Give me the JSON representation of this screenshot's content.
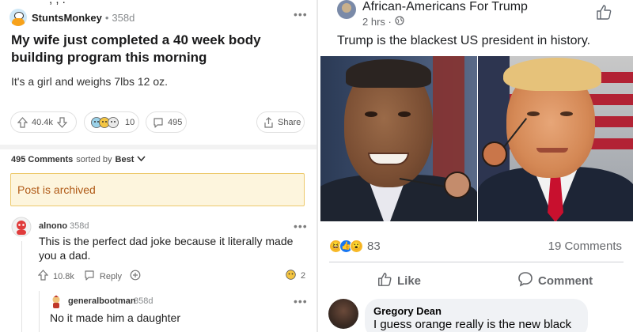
{
  "reddit": {
    "post": {
      "username": "StuntsMonkey",
      "age": "358d",
      "title": "My wife just completed a 40 week body building program this morning",
      "body": "It's a girl and weighs 7lbs 12 oz.",
      "score": "40.4k",
      "awards_count": "10",
      "comments_count": "495",
      "share_label": "Share"
    },
    "sort": {
      "count_label": "495 Comments",
      "sorted_by_label": "sorted by",
      "value": "Best"
    },
    "archived_notice": "Post is archived",
    "comments": [
      {
        "username": "alnono",
        "age": "358d",
        "text": "This is the perfect dad joke because it literally made you a dad.",
        "score": "10.8k",
        "reply_label": "Reply",
        "award_count": "2"
      },
      {
        "username": "generalbootman",
        "age": "358d",
        "text": "No it made him a daughter"
      }
    ]
  },
  "facebook": {
    "page_name": "African-Americans For Trump",
    "time": "2 hrs ·",
    "post_text": "Trump is the blackest US president in history.",
    "reaction_count": "83",
    "comments_count": "19 Comments",
    "like_label": "Like",
    "comment_label": "Comment",
    "comment": {
      "name": "Gregory Dean",
      "text": "I guess orange really is the new black"
    }
  },
  "colors": {
    "reddit_archived_bg": "#fdf5dd",
    "reddit_archived_text": "#b05a17",
    "fb_text_secondary": "#65676b",
    "fb_like_blue": "#1877f2"
  }
}
